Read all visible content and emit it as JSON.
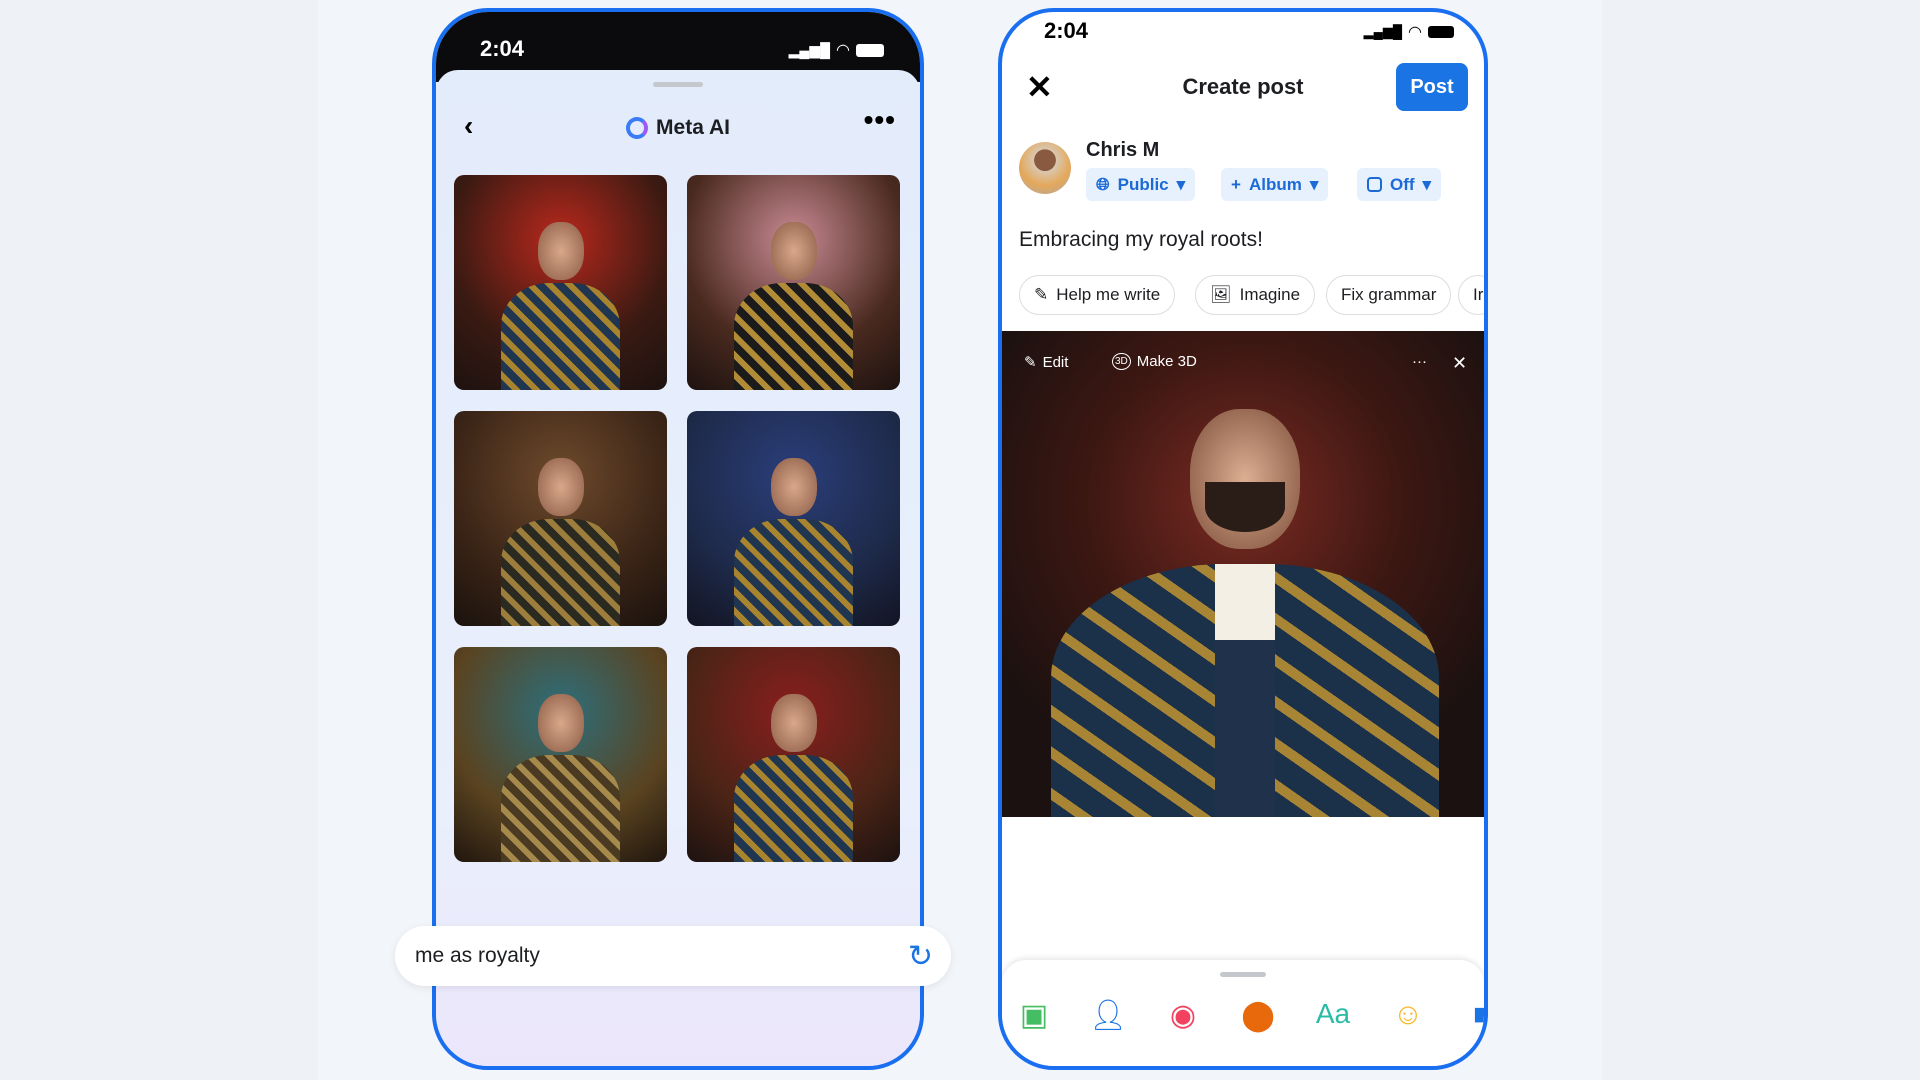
{
  "left_phone": {
    "status_time": "2:04",
    "header_title": "Meta AI",
    "back_icon": "chevron-left-icon",
    "more_icon": "more-horizontal-icon",
    "generated_images": 6,
    "prompt_value": "me as royalty",
    "regenerate_icon": "refresh-icon"
  },
  "right_phone": {
    "status_time": "2:04",
    "title": "Create post",
    "post_label": "Post",
    "user_name": "Chris M",
    "audience": "Public",
    "album": "Album",
    "instagram": "Off",
    "post_text": "Embracing my royal roots!",
    "chips": [
      "Help me write",
      "Imagine",
      "Fix grammar",
      "Ir"
    ],
    "photo_tools": {
      "edit": "Edit",
      "make3d": "Make 3D"
    },
    "toolbar_icons": [
      "photo-icon",
      "tag-people-icon",
      "live-video-icon",
      "location-icon",
      "text-style-icon",
      "feeling-icon",
      "camera-icon"
    ],
    "toolbar_text_label": "Aa"
  },
  "colors": {
    "accent": "#1b74e4",
    "frame": "#1a6ff0"
  }
}
